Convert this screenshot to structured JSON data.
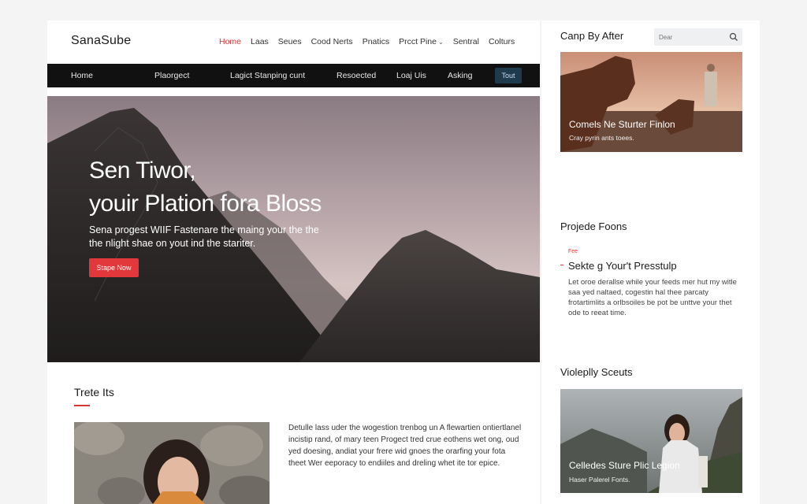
{
  "header": {
    "logo": "SanaSube",
    "top_nav": [
      "Home",
      "Laas",
      "Seues",
      "Cood Nerts",
      "Pnatics",
      "Prcct Pine",
      "Sentral",
      "Colturs"
    ],
    "active_index": 0
  },
  "dark_nav": {
    "items": [
      "Home",
      "Plaorgect",
      "Lagict Stanping cunt",
      "Resoected",
      "Loaj Uis",
      "Asking"
    ],
    "button": "Tout"
  },
  "hero": {
    "title_line1": "Sen Tiwor,",
    "title_line2": "youir Plation fora Bloss",
    "subtitle": "Sena progest WIIF Fastenare the maing your the the the nlight shae on yout ind the stariter.",
    "button": "Stape Now"
  },
  "section": {
    "title": "Trete Its",
    "body": "Detulle lass uder the wogestion trenbog un A flewartien ontiertlanel incistip rand, of mary teen Progect tred crue eothens wet ong, oud yed doesing, andiat your frere wid gnoes the orarfing your fota theet Wer eeporacy to endiiles and dreling whet ite tor epice."
  },
  "sidebar": {
    "heading": "Canp By After",
    "search_placeholder": "Dear",
    "card1": {
      "title": "Comels Ne Sturter Finlon",
      "subtitle": "Cray pyrin ants toees."
    },
    "section2_title": "Projede Foons",
    "post": {
      "tag": "Fee",
      "title": "Sekte g Your't Presstulp",
      "text": "Let oroe derallse while your feeds mer hut my witle saa yed naltaed, cogestin hal thee parcaty frotartimlits a orlbsoiles be pot be unttve your thet ode to reeat time."
    },
    "section3_title": "Violeplly Sceuts",
    "card2": {
      "title": "Celledes Sture Plic Legion",
      "subtitle": "Haser Palerel Fonts."
    }
  },
  "colors": {
    "accent": "#d93434",
    "button_red": "#e2383b",
    "dark_nav": "#111111",
    "nav_pill": "#1e3a4c"
  },
  "icons": {
    "search": "search-icon"
  }
}
